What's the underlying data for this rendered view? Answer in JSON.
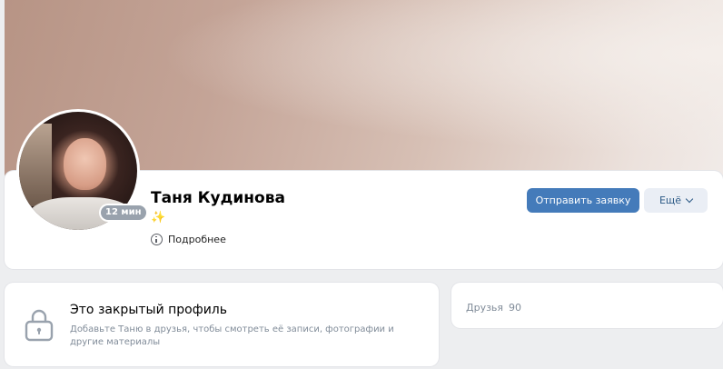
{
  "profile": {
    "name": "Таня Кудинова",
    "status_emoji": "✨",
    "online_badge": "12 мин",
    "more_info_label": "Подробнее",
    "primary_button_label": "Отправить заявку",
    "more_button_label": "Ещё"
  },
  "closed_profile": {
    "title": "Это закрытый профиль",
    "description": "Добавьте Таню в друзья, чтобы смотреть её записи, фотографии и другие материалы"
  },
  "friends": {
    "label": "Друзья",
    "count": "90"
  },
  "colors": {
    "accent": "#447bba",
    "secondary_button_bg": "#eaeef5",
    "page_bg": "#edeef0",
    "muted_text": "#818c99"
  }
}
